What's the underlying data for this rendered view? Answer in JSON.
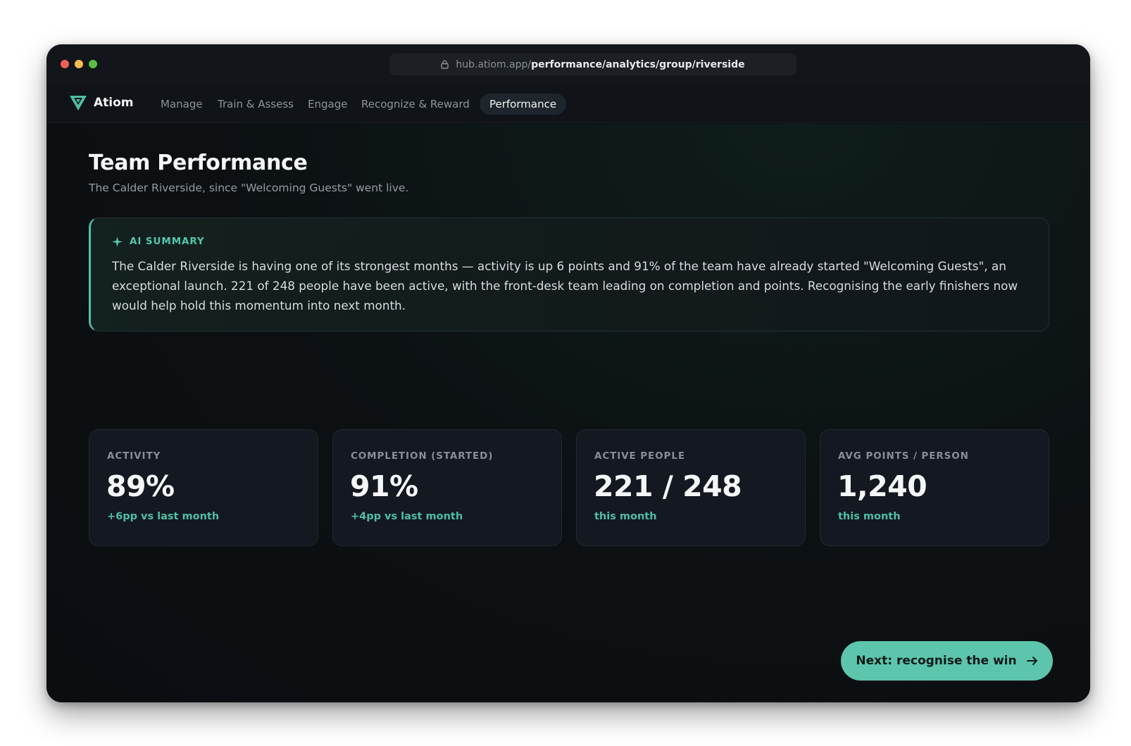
{
  "browser": {
    "url_host": "hub.atiom.app/",
    "url_path": "performance/analytics/group/riverside"
  },
  "nav": {
    "brand": "Atiom",
    "items": [
      {
        "label": "Manage"
      },
      {
        "label": "Train & Assess"
      },
      {
        "label": "Engage"
      },
      {
        "label": "Recognize & Reward"
      },
      {
        "label": "Performance",
        "active": true
      }
    ]
  },
  "page": {
    "title": "Team Performance",
    "subtitle": "The Calder Riverside, since \"Welcoming Guests\" went live."
  },
  "summary": {
    "label": "AI SUMMARY",
    "text": "The Calder Riverside is having one of its strongest months — activity is up 6 points and 91% of the team have already started \"Welcoming Guests\", an exceptional launch. 221 of 248 people have been active, with the front-desk team leading on completion and points. Recognising the early finishers now would help hold this momentum into next month."
  },
  "stats": [
    {
      "label": "ACTIVITY",
      "value": "89%",
      "note": "+6pp vs last month"
    },
    {
      "label": "COMPLETION (STARTED)",
      "value": "91%",
      "note": "+4pp vs last month"
    },
    {
      "label": "ACTIVE PEOPLE",
      "value": "221 / 248",
      "note": "this month"
    },
    {
      "label": "AVG POINTS / PERSON",
      "value": "1,240",
      "note": "this month"
    }
  ],
  "cta": {
    "label": "Next: recognise the win"
  },
  "colors": {
    "accent": "#4fbfa4",
    "button": "#5cc5ac",
    "background": "#0c0f12"
  }
}
